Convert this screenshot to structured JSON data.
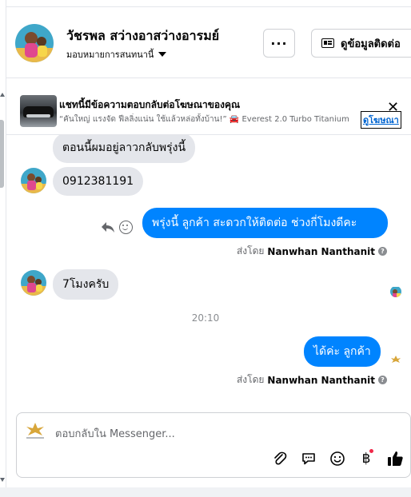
{
  "header": {
    "contact_name": "วัชรพล สว่างอาสว่างอารมย์",
    "assign_label": "มอบหมายการสนทนานี้",
    "more_label": "···",
    "contact_info_label": "ดูข้อมูลติดต่อ"
  },
  "ad_banner": {
    "title": "แชทนี้มีข้อความตอบกลับต่อโฆษณาของคุณ",
    "snippet": "“คันใหญ่ แรงจัด ฟีลลิ่งแน่น ใช้แล้วหล่อทั้งบ้าน!” 🚘 Everest 2.0 Turbo Titanium",
    "view_ad_label": "ดูโฆษณา",
    "close_label": "✕"
  },
  "messages": [
    {
      "direction": "in",
      "text": "ตอนนี้ผมอยู่ลาวกลับพรุ่งนี้"
    },
    {
      "direction": "in",
      "text": "0912381191"
    },
    {
      "direction": "out",
      "text": "พรุ่งนี้  ลูกค้า  สะดวกให้ติดต่อ ช่วงกี่โมงดีคะ"
    },
    {
      "direction": "in",
      "text": "7โมงครับ"
    },
    {
      "direction": "out",
      "text": "ได้ค่ะ  ลูกค้า"
    }
  ],
  "sent_by": {
    "prefix": "ส่งโดย",
    "agent_name": "Nanwhan Nanthanit",
    "help_symbol": "?"
  },
  "time_divider": "20:10",
  "composer": {
    "placeholder": "ตอบกลับใน Messenger...",
    "currency_symbol": "฿"
  },
  "icons": {
    "more": "more-icon",
    "contact_card": "contact-card-icon",
    "reply": "reply-icon",
    "react": "emoji-react-icon",
    "attach": "paperclip-icon",
    "saved_replies": "chat-bubble-icon",
    "emoji": "emoji-icon",
    "payment": "baht-icon",
    "like": "thumbs-up-icon"
  },
  "colors": {
    "outgoing_bubble": "#0084ff",
    "incoming_bubble": "#e4e6eb",
    "link": "#0064d1",
    "notification_dot": "#f02849"
  }
}
